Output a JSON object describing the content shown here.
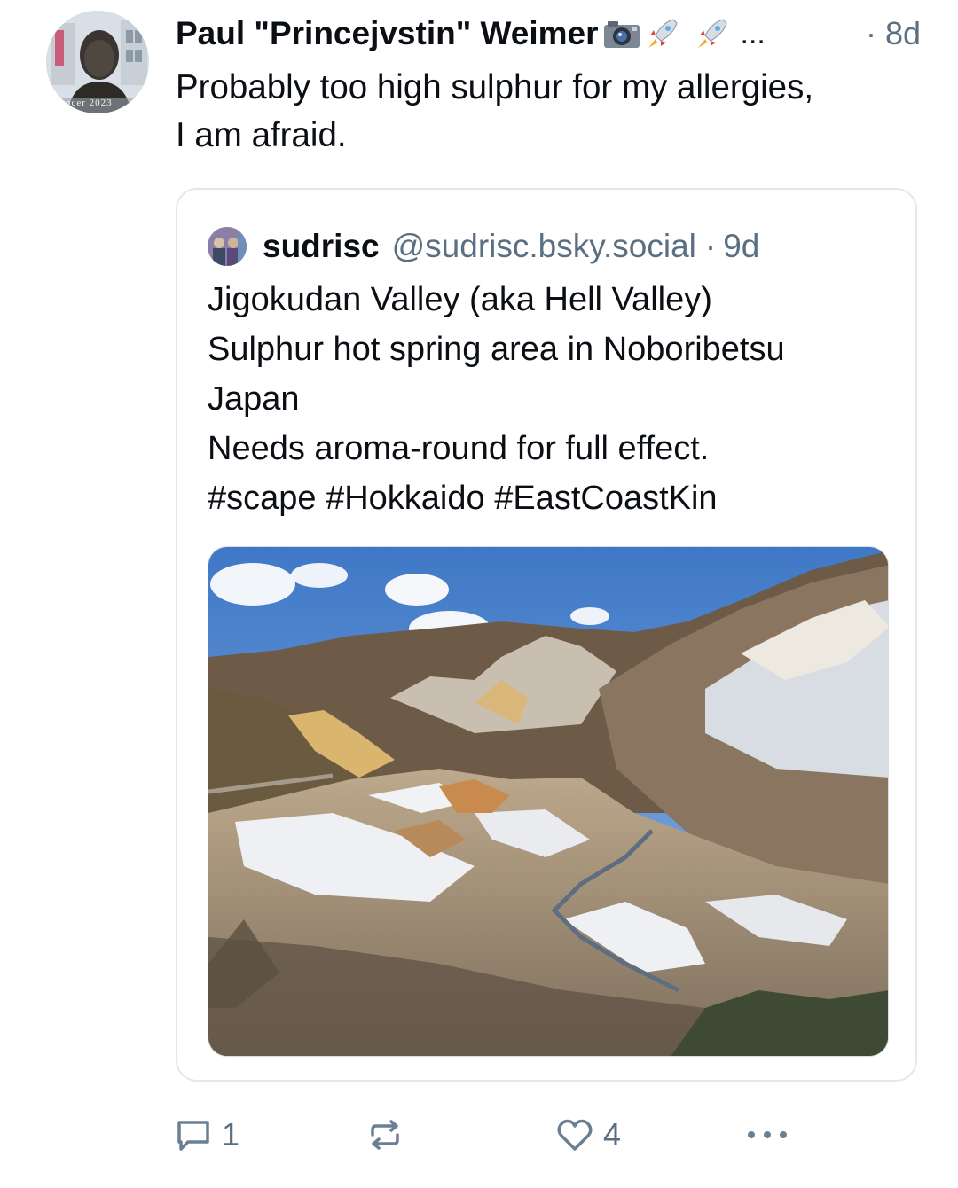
{
  "post": {
    "author_name": "Paul \"Princejvstin\" Weimer",
    "author_emojis": [
      "camera-icon",
      "rocket-icon",
      "rocket-icon"
    ],
    "ellipsis": "...",
    "time": "· 8d",
    "text_lines": [
      "Probably too high sulphur for my allergies,",
      "I am afraid."
    ],
    "avatar_caption": "ncer 2023"
  },
  "quote": {
    "name": "sudrisc",
    "handle": "@sudrisc.bsky.social",
    "sep": "·",
    "time": "9d",
    "text_lines": [
      "Jigokudan Valley (aka Hell Valley)",
      "Sulphur hot spring area in Noboribetsu",
      "Japan",
      "Needs aroma-round for full effect.",
      "#scape #Hokkaido #EastCoastKin"
    ]
  },
  "actions": {
    "reply_count": "1",
    "repost_count": "",
    "like_count": "4",
    "more_icon": "more-icon"
  },
  "colors": {
    "text": "#0b0f14",
    "muted": "#5b6f82",
    "border": "#e3e8ee",
    "icon": "#6b7f93"
  }
}
